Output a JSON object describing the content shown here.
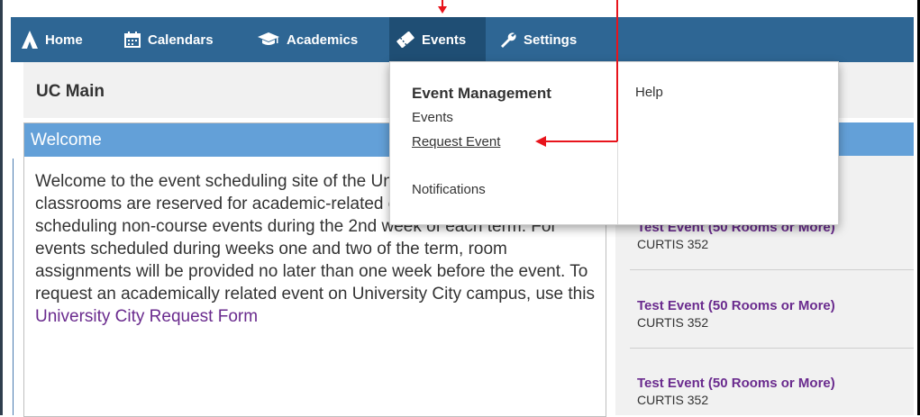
{
  "nav": {
    "items": [
      {
        "label": "Home",
        "icon": "logo-icon"
      },
      {
        "label": "Calendars",
        "icon": "calendar-icon"
      },
      {
        "label": "Academics",
        "icon": "graduation-cap-icon"
      },
      {
        "label": "Events",
        "icon": "ticket-icon"
      },
      {
        "label": "Settings",
        "icon": "wrench-icon"
      }
    ],
    "active": "Events"
  },
  "page": {
    "title": "UC Main"
  },
  "welcome": {
    "heading": "Welcome",
    "text": "Welcome to the event scheduling site of the University Registrar where classrooms are reserved for academic-related events. We will begin scheduling non-course events during the 2nd week of each term. For events scheduled during weeks one and two of the term, room assignments will be provided no later than one week before the event. To request an academically related event on University City campus, use this ",
    "link_text": "University City Request Form"
  },
  "dropdown": {
    "section_title": "Event Management",
    "items": [
      "Events",
      "Request Event",
      "Notifications"
    ],
    "right_item": "Help"
  },
  "events": [
    {
      "title": "Test Event (50 Rooms or More)",
      "room": "CURTIS 352"
    },
    {
      "title": "Test Event (50 Rooms or More)",
      "room": "CURTIS 352"
    },
    {
      "title": "Test Event (50 Rooms or More)",
      "room": "CURTIS 352"
    }
  ],
  "colors": {
    "navbar": "#2e6694",
    "accent_header": "#63a0d8",
    "link_purple": "#6a2b8e",
    "annotation_arrow": "#e8141c"
  }
}
